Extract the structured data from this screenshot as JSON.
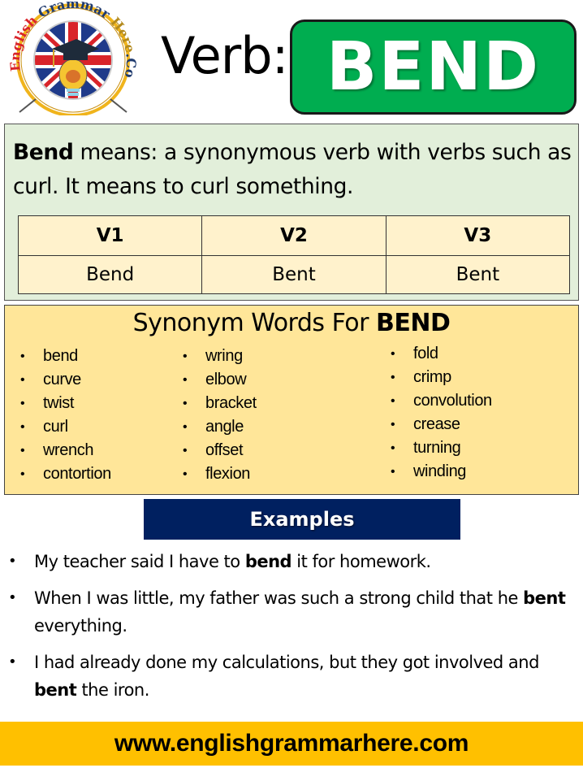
{
  "logo": {
    "text_top": "English Grammar Here.Com",
    "parts": [
      "English",
      "Grammar",
      "Here",
      ".Com"
    ],
    "colors": {
      "ring": "#f0b41c",
      "red": "#d9242a",
      "navy": "#1f3a6e",
      "gold": "#b38a1e"
    }
  },
  "header": {
    "verb_label": "Verb:",
    "verb": "BEND",
    "badge_color": "#00ad50"
  },
  "meaning": {
    "word": "Bend",
    "text": " means: a synonymous verb with verbs such as curl. It means to curl something."
  },
  "forms": {
    "headers": [
      "V1",
      "V2",
      "V3"
    ],
    "values": [
      "Bend",
      "Bent",
      "Bent"
    ]
  },
  "synonyms": {
    "title_prefix": "Synonym Words For ",
    "title_word": "BEND",
    "bullet": "•",
    "columns": [
      [
        "bend",
        "curve",
        "twist",
        "curl",
        "wrench",
        "contortion"
      ],
      [
        "wring",
        "elbow",
        "bracket",
        "angle",
        "offset",
        "flexion"
      ],
      [
        "fold",
        "crimp",
        "convolution",
        "crease",
        "turning",
        "winding"
      ]
    ]
  },
  "examples": {
    "title": "Examples",
    "bullet": "•",
    "items": [
      {
        "before": "My teacher said I have to ",
        "bold": "bend",
        "after": " it for homework."
      },
      {
        "before": "When I was little, my father was such a strong child that he ",
        "bold": "bent",
        "after": " everything."
      },
      {
        "before": "I had already done my calculations, but they got involved and ",
        "bold": "bent",
        "after": " the iron."
      }
    ]
  },
  "footer": {
    "url": "www.englishgrammarhere.com"
  }
}
